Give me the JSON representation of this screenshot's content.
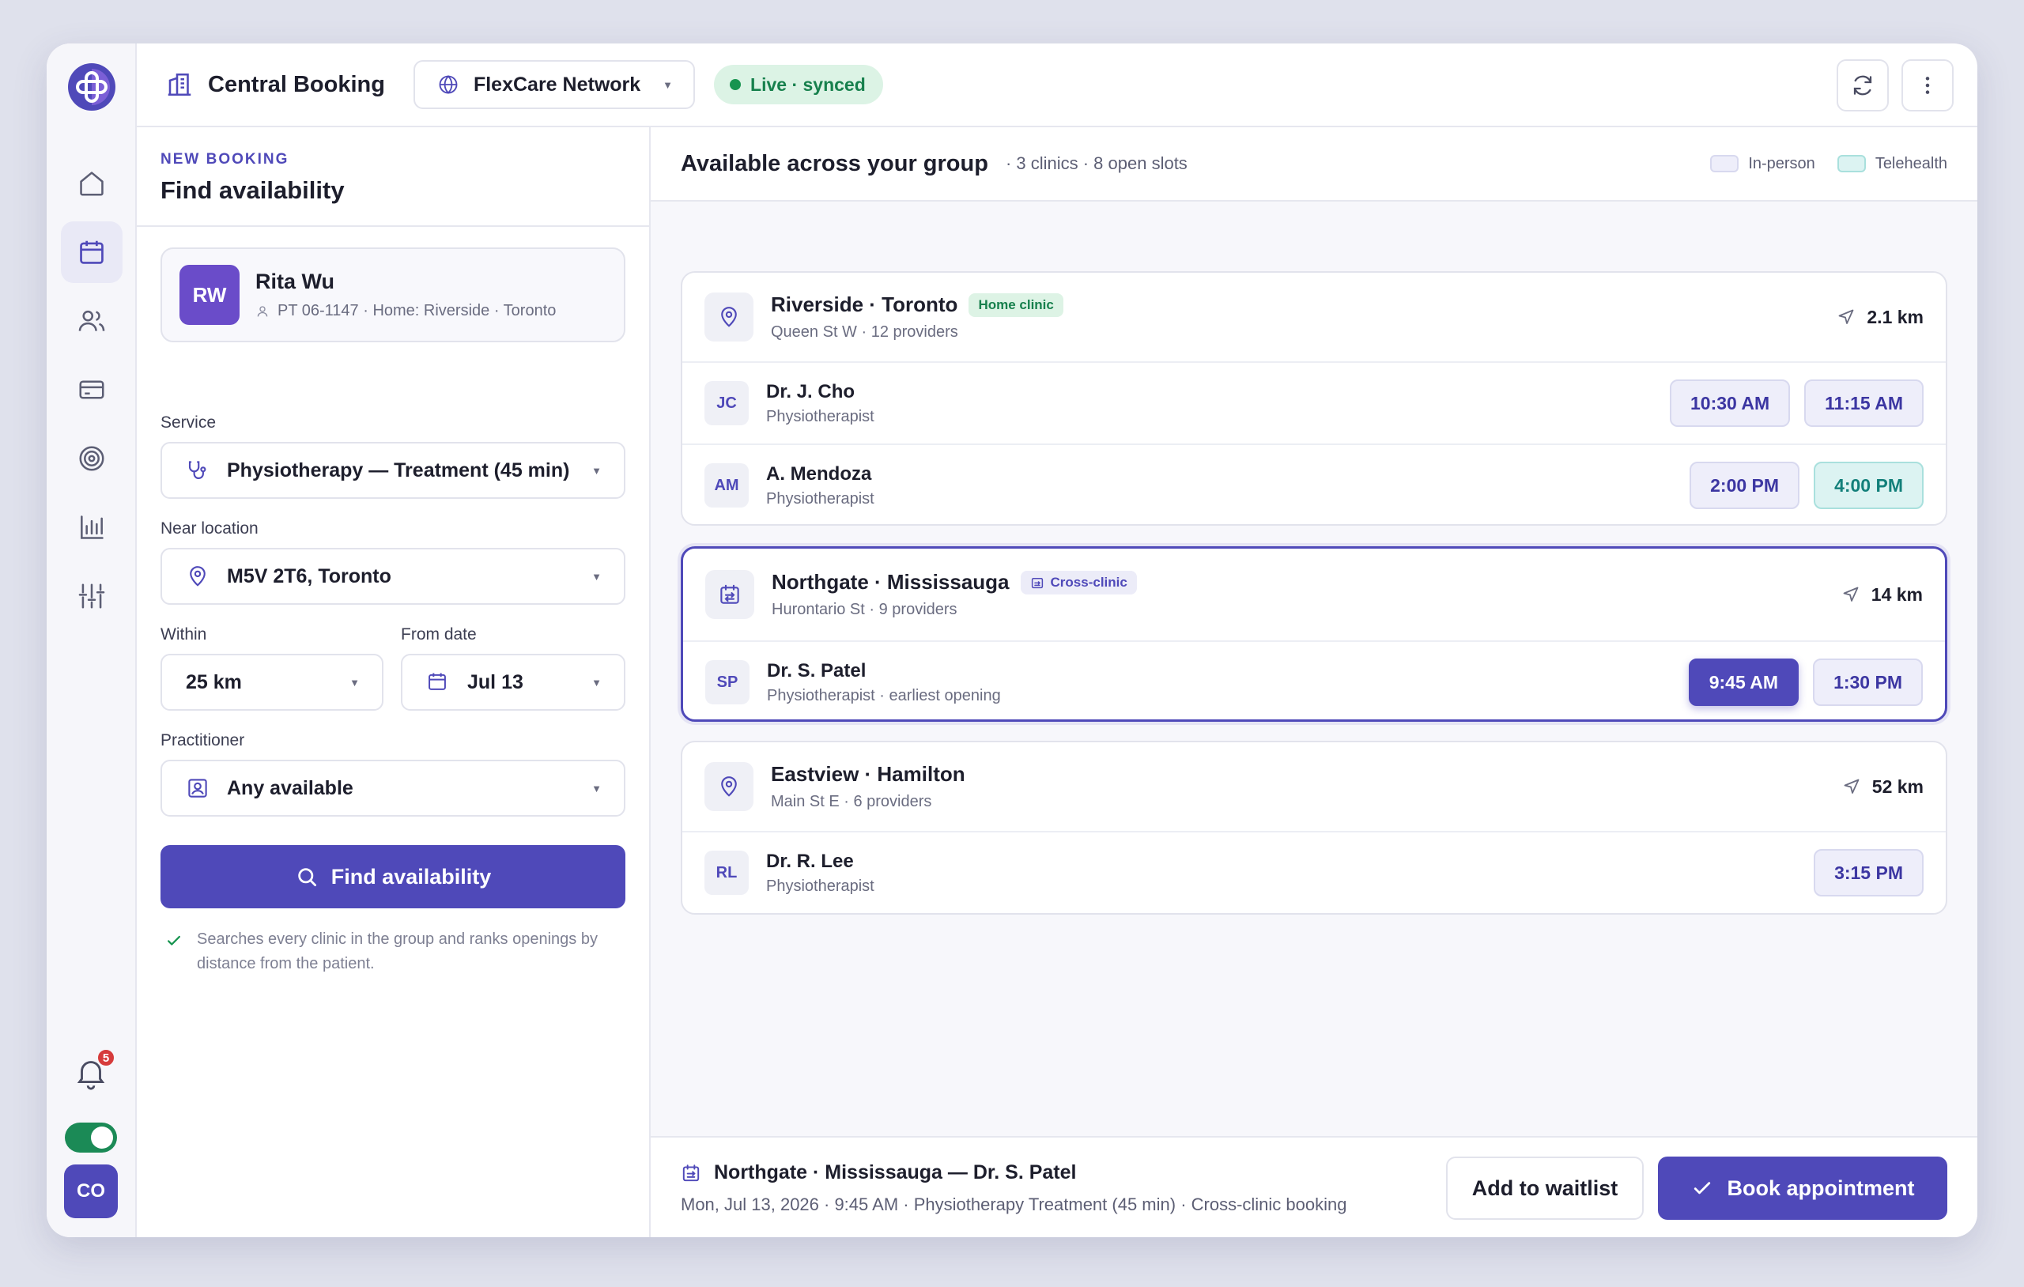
{
  "app": {
    "title": "Central Booking",
    "network": "FlexCare Network",
    "status": "Live · synced"
  },
  "sidebar": {
    "items": [
      {
        "name": "home",
        "icon": "home-icon"
      },
      {
        "name": "calendar",
        "icon": "calendar-icon",
        "active": true
      },
      {
        "name": "patients",
        "icon": "users-icon"
      },
      {
        "name": "billing",
        "icon": "credit-card-icon"
      },
      {
        "name": "goals",
        "icon": "target-icon"
      },
      {
        "name": "reports",
        "icon": "bar-chart-icon"
      },
      {
        "name": "settings",
        "icon": "sliders-icon"
      }
    ],
    "notifications_count": "5",
    "user_initials": "CO"
  },
  "booking": {
    "eyebrow": "NEW BOOKING",
    "title": "Find availability",
    "patient": {
      "initials": "RW",
      "name": "Rita Wu",
      "meta": "PT 06-1147 · Home: Riverside · Toronto"
    },
    "service_label": "Service",
    "service_value": "Physiotherapy — Treatment (45 min)",
    "location_label": "Near location",
    "location_value": "M5V 2T6, Toronto",
    "within_label": "Within",
    "within_value": "25 km",
    "from_label": "From date",
    "from_value": "Jul 13",
    "practitioner_label": "Practitioner",
    "practitioner_value": "Any available",
    "find_button": "Find availability",
    "note": "Searches every clinic in the group and ranks openings by distance from the patient."
  },
  "results": {
    "title": "Available across your group",
    "summary": "· 3 clinics · 8 open slots",
    "legend_in_person": "In-person",
    "legend_telehealth": "Telehealth",
    "colors": {
      "accent": "#4f49b9",
      "in_person": "#eeeefa",
      "telehealth": "#dcf3f2",
      "home_tag": "#17804d"
    },
    "clinics": [
      {
        "name": "Riverside · Toronto",
        "tag": "Home clinic",
        "sub": "Queen St W · 12 providers",
        "distance": "2.1 km",
        "providers": [
          {
            "initials": "JC",
            "name": "Dr. J. Cho",
            "role": "Physiotherapist",
            "slots": [
              {
                "time": "10:30 AM",
                "type": "in-person"
              },
              {
                "time": "11:15 AM",
                "type": "in-person"
              }
            ]
          },
          {
            "initials": "AM",
            "name": "A. Mendoza",
            "role": "Physiotherapist",
            "slots": [
              {
                "time": "2:00 PM",
                "type": "in-person"
              },
              {
                "time": "4:00 PM",
                "type": "telehealth"
              }
            ]
          }
        ]
      },
      {
        "name": "Northgate · Mississauga",
        "tag": "Cross-clinic",
        "sub": "Hurontario St · 9 providers",
        "distance": "14 km",
        "providers": [
          {
            "initials": "SP",
            "name": "Dr. S. Patel",
            "role": "Physiotherapist · earliest opening",
            "slots": [
              {
                "time": "9:45 AM",
                "type": "selected"
              },
              {
                "time": "1:30 PM",
                "type": "in-person"
              }
            ]
          }
        ]
      },
      {
        "name": "Eastview · Hamilton",
        "tag": "",
        "sub": "Main St E · 6 providers",
        "distance": "52 km",
        "providers": [
          {
            "initials": "RL",
            "name": "Dr. R. Lee",
            "role": "Physiotherapist",
            "slots": [
              {
                "time": "3:15 PM",
                "type": "in-person"
              }
            ]
          }
        ]
      }
    ]
  },
  "footer": {
    "selection": "Northgate · Mississauga — Dr. S. Patel",
    "details": "Mon, Jul 13, 2026 · 9:45 AM · Physiotherapy Treatment (45 min) · Cross-clinic booking",
    "waitlist_button": "Add to waitlist",
    "book_button": "Book appointment"
  }
}
